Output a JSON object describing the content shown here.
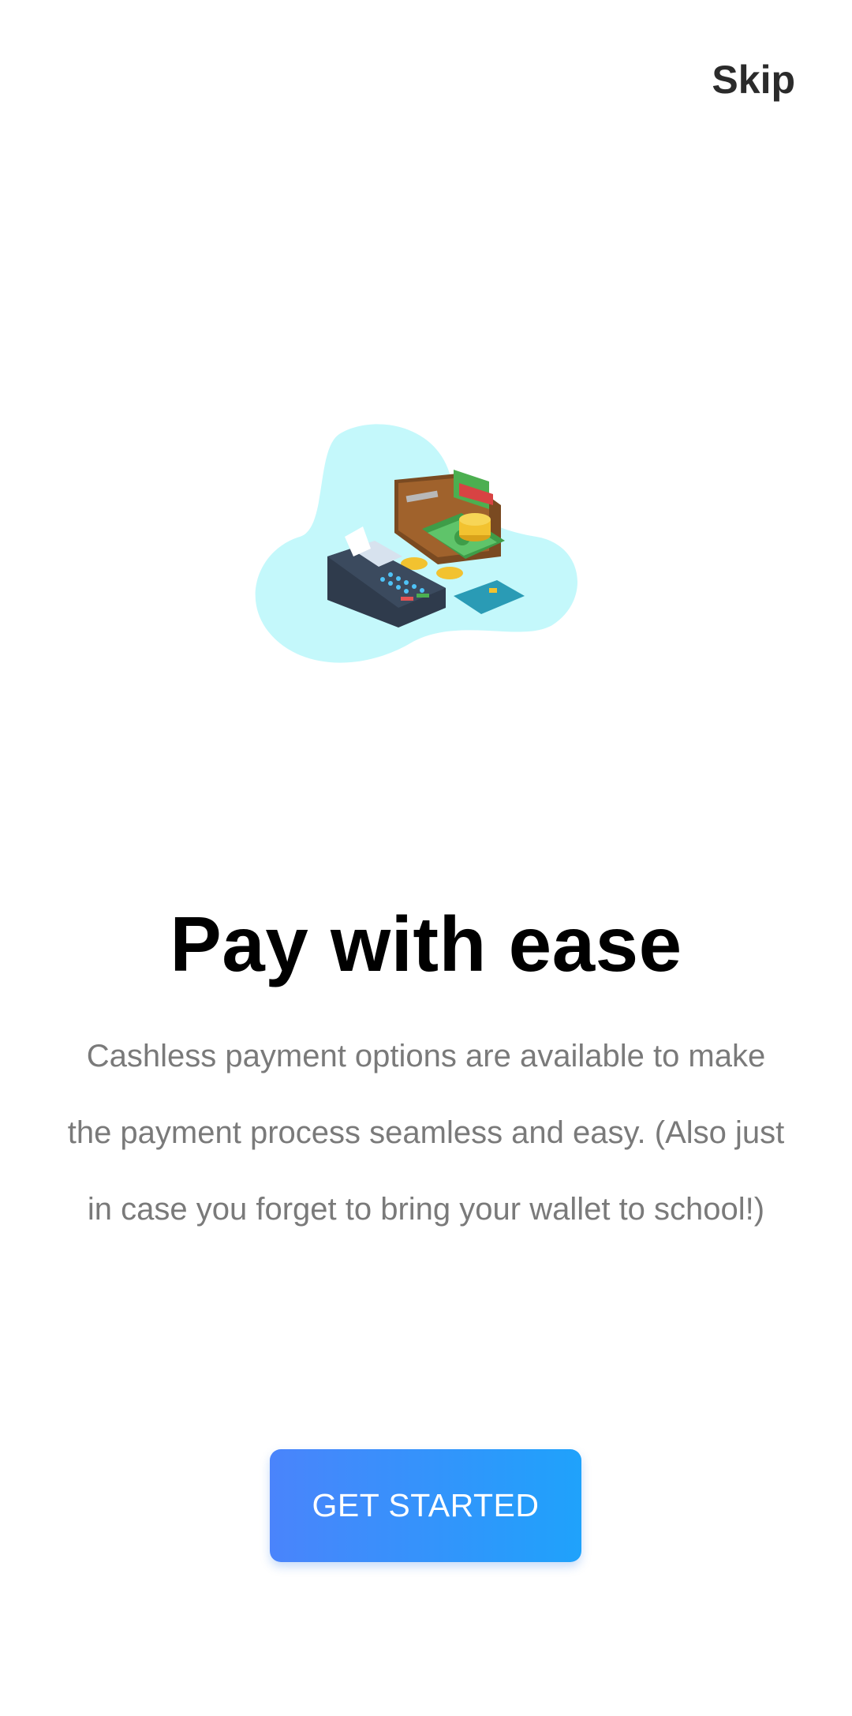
{
  "header": {
    "skip_label": "Skip"
  },
  "onboarding": {
    "illustration": "wallet-payment-terminal-illustration",
    "title": "Pay with ease",
    "description": "Cashless payment options are available to make the payment process seamless and easy. (Also just in case you forget to bring your wallet to school!)",
    "cta_label": "GET STARTED"
  },
  "colors": {
    "background": "#ffffff",
    "title": "#000000",
    "description": "#7a7a7a",
    "skip": "#2b2b2b",
    "cta_gradient_start": "#4a84fb",
    "cta_gradient_end": "#1fa2fb",
    "blob": "#c4f8fb"
  }
}
